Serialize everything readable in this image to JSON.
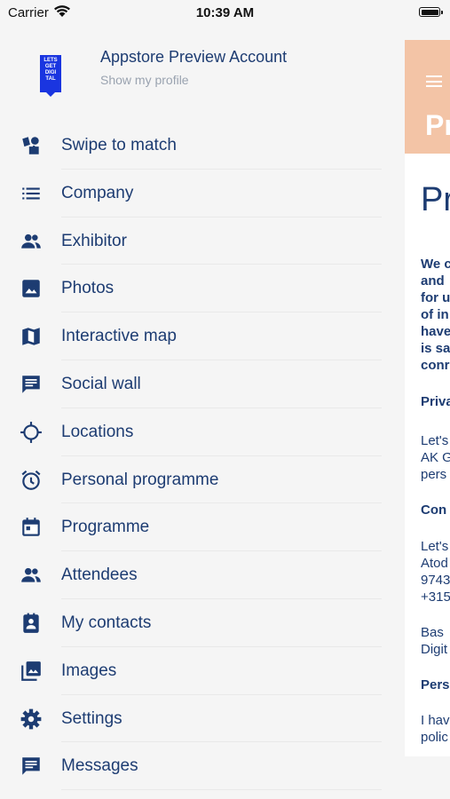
{
  "status_bar": {
    "carrier": "Carrier",
    "time": "10:39 AM"
  },
  "profile": {
    "logo_text": "LETS GET DIGI TAL",
    "name": "Appstore Preview Account",
    "link": "Show my profile"
  },
  "menu": [
    {
      "label": "Swipe to match",
      "icon": "swipe-match-icon"
    },
    {
      "label": "Company",
      "icon": "list-icon"
    },
    {
      "label": "Exhibitor",
      "icon": "people-icon"
    },
    {
      "label": "Photos",
      "icon": "photo-icon"
    },
    {
      "label": "Interactive map",
      "icon": "map-icon"
    },
    {
      "label": "Social wall",
      "icon": "chat-icon"
    },
    {
      "label": "Locations",
      "icon": "crosshair-icon"
    },
    {
      "label": "Personal programme",
      "icon": "alarm-icon"
    },
    {
      "label": "Programme",
      "icon": "calendar-icon"
    },
    {
      "label": "Attendees",
      "icon": "people-icon"
    },
    {
      "label": "My contacts",
      "icon": "contact-card-icon"
    },
    {
      "label": "Images",
      "icon": "photo-library-icon"
    },
    {
      "label": "Settings",
      "icon": "gear-icon"
    },
    {
      "label": "Messages",
      "icon": "message-icon"
    }
  ],
  "peek": {
    "header_title": "Pr",
    "title": "Pr",
    "lines": [
      {
        "text": "We c",
        "bold": true
      },
      {
        "text": "and",
        "bold": true
      },
      {
        "text": "for u",
        "bold": true
      },
      {
        "text": "of in",
        "bold": true
      },
      {
        "text": "have",
        "bold": true
      },
      {
        "text": "is sa",
        "bold": true
      },
      {
        "text": "conr",
        "bold": true
      },
      {
        "text": "Priva",
        "bold": true
      },
      {
        "text": "Let's",
        "bold": false
      },
      {
        "text": "AK G",
        "bold": false
      },
      {
        "text": "pers",
        "bold": false
      },
      {
        "text": "Con",
        "bold": true
      },
      {
        "text": "Let's",
        "bold": false
      },
      {
        "text": "Atod",
        "bold": false
      },
      {
        "text": "9743",
        "bold": false
      },
      {
        "text": "+315",
        "bold": false
      },
      {
        "text": "Bas",
        "bold": false
      },
      {
        "text": "Digit",
        "bold": false
      },
      {
        "text": "Pers",
        "bold": true
      },
      {
        "text": "I hav",
        "bold": false
      },
      {
        "text": "polic",
        "bold": false
      }
    ]
  },
  "colors": {
    "accent": "#1d3c72",
    "header_peach": "#f3c4a6",
    "logo_blue": "#1a35e0"
  }
}
